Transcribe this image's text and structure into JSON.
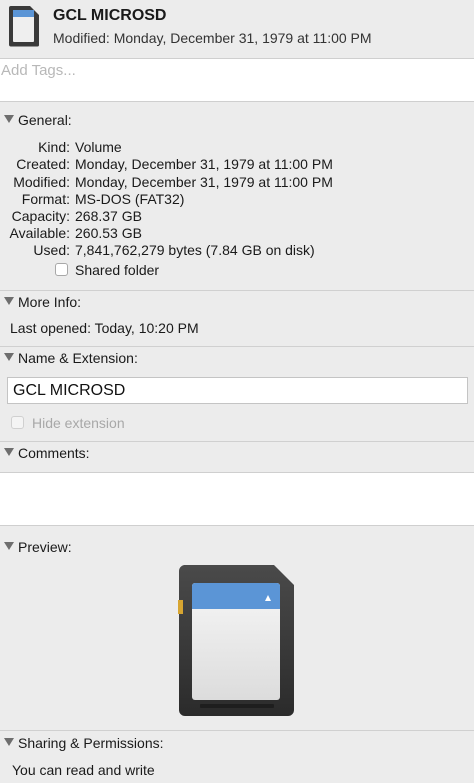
{
  "header": {
    "title": "GCL MICROSD",
    "modified": "Modified: Monday, December 31, 1979 at 11:00 PM",
    "icon": "sd-card-icon"
  },
  "tags": {
    "placeholder": "Add Tags..."
  },
  "general": {
    "label": "General:",
    "rows": [
      {
        "key": "Kind:",
        "value": "Volume"
      },
      {
        "key": "Created:",
        "value": "Monday, December 31, 1979 at 11:00 PM"
      },
      {
        "key": "Modified:",
        "value": "Monday, December 31, 1979 at 11:00 PM"
      },
      {
        "key": "Format:",
        "value": "MS-DOS (FAT32)"
      },
      {
        "key": "Capacity:",
        "value": "268.37 GB"
      },
      {
        "key": "Available:",
        "value": "260.53 GB"
      },
      {
        "key": "Used:",
        "value": "7,841,762,279 bytes (7.84 GB on disk)"
      }
    ],
    "shared_folder": {
      "label": "Shared folder",
      "checked": false
    }
  },
  "more_info": {
    "label": "More Info:",
    "last_opened": "Last opened: Today, 10:20 PM"
  },
  "name_extension": {
    "label": "Name & Extension:",
    "name_value": "GCL MICROSD",
    "hide_extension": {
      "label": "Hide extension",
      "checked": false,
      "enabled": false
    }
  },
  "comments": {
    "label": "Comments:",
    "value": ""
  },
  "preview": {
    "label": "Preview:",
    "icon": "sd-card-preview-icon"
  },
  "sharing": {
    "label": "Sharing & Permissions:",
    "text": "You can read and write"
  },
  "colors": {
    "panel_bg": "#ececec",
    "card_body": "#3a3a3a",
    "card_label_blue": "#5b95d6",
    "card_contact_gold": "#d7a531"
  }
}
